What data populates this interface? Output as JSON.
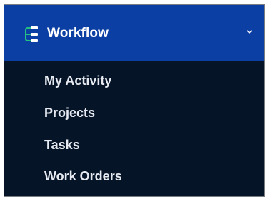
{
  "menu": {
    "title": "Workflow",
    "icon": "workflow-icon",
    "toggle_icon": "chevron-down-icon",
    "expanded": true,
    "items": [
      {
        "label": "My Activity"
      },
      {
        "label": "Projects"
      },
      {
        "label": "Tasks"
      },
      {
        "label": "Work Orders"
      }
    ]
  },
  "colors": {
    "header_bg": "#0b3fa3",
    "submenu_bg": "#061428",
    "icon_accent": "#26c281",
    "text": "#ffffff"
  }
}
